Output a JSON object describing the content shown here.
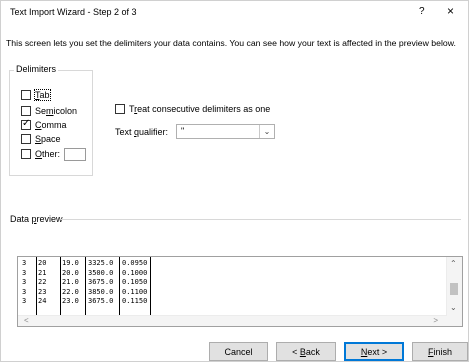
{
  "window": {
    "title": "Text Import Wizard - Step 2 of 3",
    "help": "?",
    "close": "×"
  },
  "description": "This screen lets you set the delimiters your data contains.  You can see how your text is affected in the preview below.",
  "delimiters": {
    "legend": "Delimiters",
    "items": [
      {
        "label": "Tab",
        "checked": false
      },
      {
        "label": "Semicolon",
        "checked": false
      },
      {
        "label": "Comma",
        "checked": true
      },
      {
        "label": "Space",
        "checked": false
      },
      {
        "label": "Other:",
        "checked": false,
        "value": ""
      }
    ]
  },
  "consecutive": {
    "label": "Treat consecutive delimiters as one",
    "checked": false
  },
  "qualifier": {
    "label": "Text qualifier:",
    "value": "\""
  },
  "preview": {
    "label": "Data preview",
    "rows": [
      [
        "3",
        "20",
        "19.0",
        "3325.0",
        "0.0950"
      ],
      [
        "3",
        "21",
        "20.0",
        "3500.0",
        "0.1000"
      ],
      [
        "3",
        "22",
        "21.0",
        "3675.0",
        "0.1050"
      ],
      [
        "3",
        "23",
        "22.0",
        "3850.0",
        "0.1100"
      ],
      [
        "3",
        "24",
        "23.0",
        "3675.0",
        "0.1150"
      ]
    ]
  },
  "buttons": {
    "cancel": "Cancel",
    "back": "< Back",
    "next": "Next >",
    "finish": "Finish"
  }
}
